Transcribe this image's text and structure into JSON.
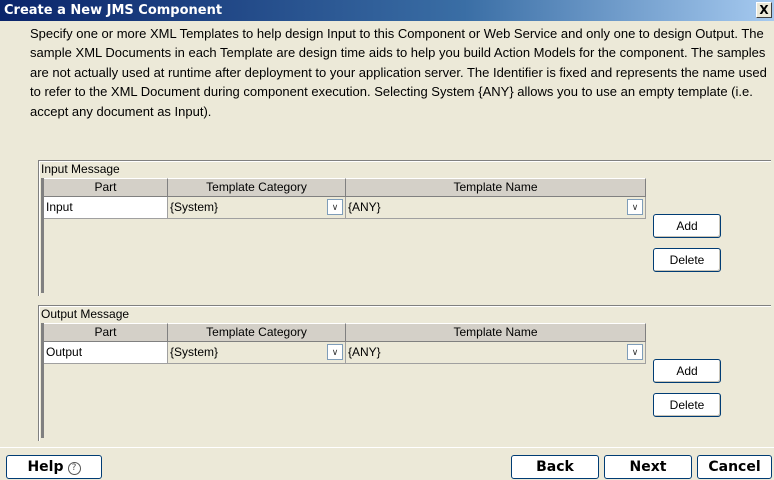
{
  "window": {
    "title": "Create a New JMS Component",
    "close_label": "X"
  },
  "description": "Specify one or more XML Templates to help design Input to this Component or Web Service and only one to design Output.  The sample XML Documents in each Template are design time aids to help you build Action Models for the component.  The samples are not actually used at runtime after deployment to your application server.  The Identifier is fixed and represents the name used to refer to the XML Document during component execution.  Selecting System {ANY} allows you to use an empty template (i.e. accept any document as Input).",
  "input_group": {
    "label": "Input Message",
    "columns": [
      "Part",
      "Template Category",
      "Template Name"
    ],
    "row": {
      "part": "Input",
      "category": "{System}",
      "name": "{ANY}"
    },
    "add_label": "Add",
    "delete_label": "Delete"
  },
  "output_group": {
    "label": "Output Message",
    "columns": [
      "Part",
      "Template Category",
      "Template Name"
    ],
    "row": {
      "part": "Output",
      "category": "{System}",
      "name": "{ANY}"
    },
    "add_label": "Add",
    "delete_label": "Delete"
  },
  "footer": {
    "help_label": "Help",
    "help_icon": "help-circle-icon",
    "back_label": "Back",
    "next_label": "Next",
    "cancel_label": "Cancel"
  }
}
